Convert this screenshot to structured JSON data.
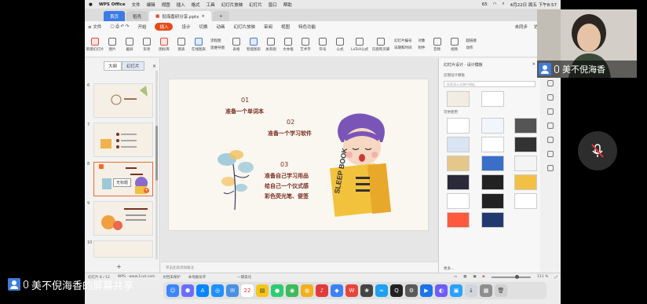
{
  "mac_menubar": {
    "app": "WPS Office",
    "items": [
      "文件",
      "编辑",
      "视图",
      "插入",
      "格式",
      "工具",
      "幻灯片放映",
      "幻灯片",
      "窗口",
      "帮助"
    ],
    "battery": "65",
    "datetime": "4月22日 周五 下午8:57"
  },
  "tabs": {
    "home": "首页",
    "shell": "稻壳",
    "document": "倪海香研分享.pptx",
    "add": "+"
  },
  "menubar": {
    "file": "文件",
    "items": [
      "开始",
      "插入",
      "设计",
      "切换",
      "动画",
      "幻灯片放映",
      "审阅",
      "视图",
      "特色功能"
    ],
    "active_index": 1,
    "right": [
      "未同步",
      "协作",
      "分享"
    ]
  },
  "ribbon": {
    "buttons": [
      "新建幻灯片",
      "图片",
      "截屏",
      "形状",
      "图标库",
      "图表",
      "在线图表",
      "流程图",
      "思维导图",
      "表格",
      "智能图形",
      "关系图",
      "文本框",
      "艺术字",
      "符号",
      "公式",
      "LaTeX公式",
      "页眉和页脚",
      "幻灯片编号",
      "对象",
      "日期和时间",
      "音频",
      "视频",
      "超链接",
      "附件",
      "动作"
    ]
  },
  "left_panel": {
    "tabs": [
      "大纲",
      "幻灯片"
    ],
    "active_tab": "幻灯片",
    "slide_numbers": [
      "6",
      "7",
      "8",
      "9",
      "10"
    ],
    "selected_slide": "8",
    "tooltip": "无标题",
    "add": "+"
  },
  "slide": {
    "item1_num": "01",
    "item1": "准备一个单词本",
    "item2_num": "02",
    "item2": "准备一个学习软件",
    "item3_num": "03",
    "item3_lines": [
      "准备自己学习用品",
      "给自己一个仪式感",
      "彩色荧光笔、便签"
    ],
    "book_text": "SLEEP BOOK"
  },
  "notes_placeholder": "单击此处添加备注",
  "right_panel": {
    "title": "幻灯片设计 · 设计模板",
    "recent": "近期设计模板",
    "search_placeholder": "搜索演示文稿中模板",
    "recommended": "可供使用",
    "footer": "更多..."
  },
  "statusbar": {
    "slide_info": "幻灯片 8 / 12",
    "theme": "WPS · www.1cut.com",
    "protect": "文档未保护",
    "backup": "本地备份开",
    "beautify": "一键美化",
    "zoom": "111 %"
  },
  "webcam": {
    "name": "美不倪海香"
  },
  "bottom_label": "美不倪海香的屏幕共享",
  "colors": {
    "accent": "#e64a19",
    "home_tab": "#3c7be5",
    "slide_text": "#7a2f22"
  }
}
